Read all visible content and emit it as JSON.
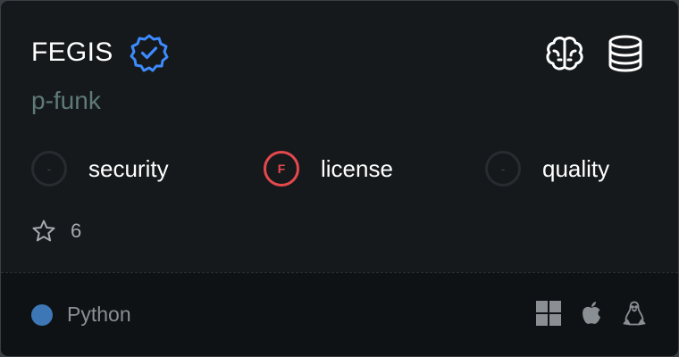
{
  "card": {
    "title": "FEGIS",
    "owner": "p-funk",
    "verified_icon": "verified-badge-icon",
    "top_icons": [
      "brain-icon",
      "database-icon"
    ],
    "scores": [
      {
        "label": "security",
        "grade": "-",
        "state": "none"
      },
      {
        "label": "license",
        "grade": "F",
        "state": "fail"
      },
      {
        "label": "quality",
        "grade": "-",
        "state": "none"
      }
    ],
    "stars": "6",
    "language": {
      "name": "Python",
      "color": "#3d77b5"
    },
    "platforms": [
      "windows-icon",
      "apple-icon",
      "linux-icon"
    ]
  },
  "colors": {
    "card_bg": "#15191c",
    "footer_bg": "#0f1214",
    "verified": "#3d8bfd",
    "fail": "#e5484d",
    "owner_text": "#5f7a78"
  }
}
